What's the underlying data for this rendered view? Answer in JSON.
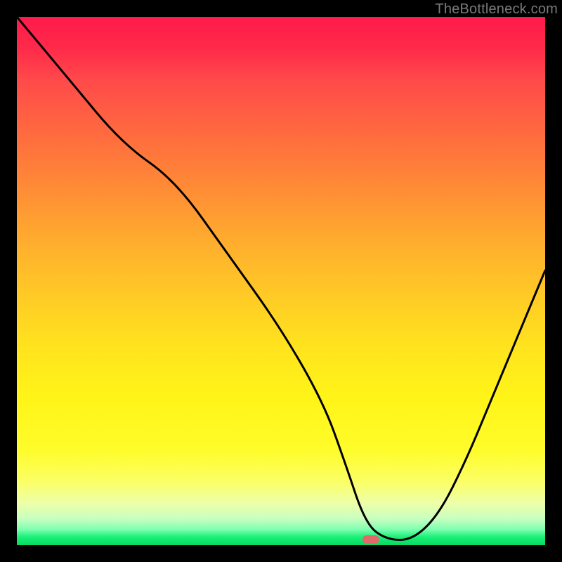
{
  "watermark": "TheBottleneck.com",
  "chart_data": {
    "type": "line",
    "title": "",
    "xlabel": "",
    "ylabel": "",
    "xlim": [
      0,
      100
    ],
    "ylim": [
      0,
      100
    ],
    "grid": false,
    "series": [
      {
        "name": "curve",
        "color": "#000000",
        "x": [
          0,
          10,
          20,
          30,
          40,
          50,
          58,
          62,
          66,
          70,
          75,
          80,
          85,
          90,
          95,
          100
        ],
        "y": [
          100,
          88,
          76,
          69,
          55,
          41,
          27,
          16,
          4,
          1,
          1,
          6,
          16,
          28,
          40,
          52
        ]
      }
    ],
    "marker": {
      "x": 67,
      "y": 1,
      "color": "#e06a6a"
    },
    "background_gradient": [
      {
        "stop": 0.0,
        "color": "#ff1a4a"
      },
      {
        "stop": 0.5,
        "color": "#ffc826"
      },
      {
        "stop": 0.85,
        "color": "#fffc2a"
      },
      {
        "stop": 1.0,
        "color": "#08d860"
      }
    ]
  }
}
